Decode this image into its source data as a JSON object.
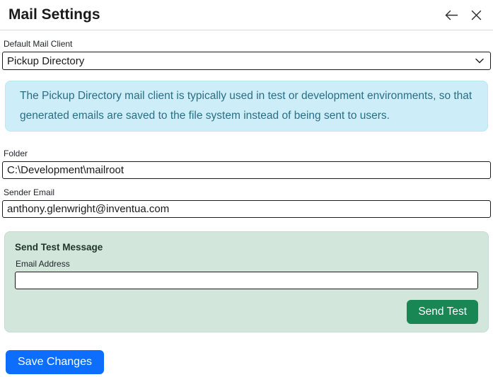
{
  "header": {
    "title": "Mail Settings"
  },
  "fields": {
    "default_mail_client": {
      "label": "Default Mail Client",
      "value": "Pickup Directory"
    },
    "folder": {
      "label": "Folder",
      "value": "C:\\Development\\mailroot"
    },
    "sender_email": {
      "label": "Sender Email",
      "value": "anthony.glenwright@inventua.com"
    }
  },
  "info_message": "The Pickup Directory mail client is typically used in test or development environments, so that generated emails are saved to the file system instead of being sent to users.",
  "send_test": {
    "title": "Send Test Message",
    "email_label": "Email Address",
    "email_value": "",
    "button_label": "Send Test"
  },
  "save_button_label": "Save Changes",
  "colors": {
    "primary": "#0d6efd",
    "success": "#198754",
    "info_background": "#cdeef8",
    "info_text": "#2a6e85",
    "panel_background": "#d3e6dc"
  }
}
